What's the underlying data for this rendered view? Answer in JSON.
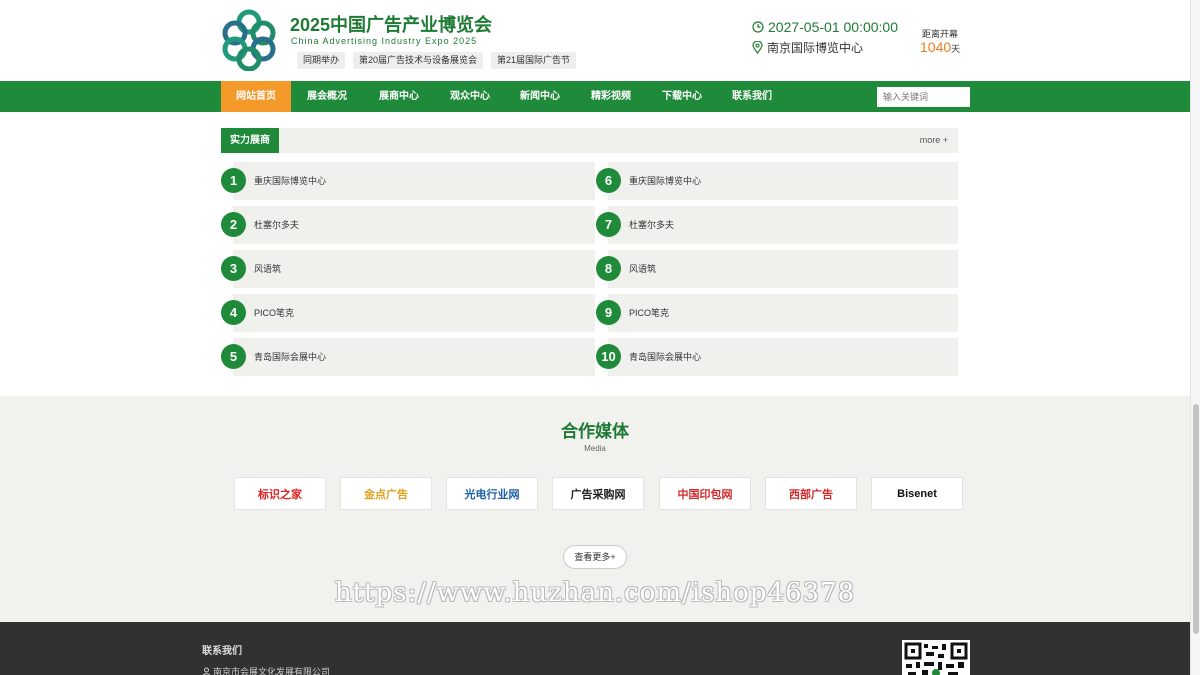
{
  "header": {
    "title": "2025中国广告产业博览会",
    "subtitle": "China Advertising Industry Expo 2025",
    "tags": [
      "同期举办",
      "第20届广告技术与设备展览会",
      "第21届国际广告节"
    ],
    "date": "2027-05-01 00:00:00",
    "venue": "南京国际博览中心",
    "countdown_label": "距离开幕",
    "countdown_value": "1040",
    "countdown_unit": "天",
    "brand_color": "#1e8a3a",
    "accent_color": "#f49a2b"
  },
  "nav": {
    "items": [
      "网站首页",
      "展会概况",
      "展商中心",
      "观众中心",
      "新闻中心",
      "精彩视频",
      "下载中心",
      "联系我们"
    ],
    "active_index": 0,
    "search_placeholder": "输入关键词"
  },
  "exhibitors": {
    "title": "实力展商",
    "more": "more +",
    "items": [
      {
        "num": "1",
        "name": "重庆国际博览中心"
      },
      {
        "num": "2",
        "name": "杜塞尔多夫"
      },
      {
        "num": "3",
        "name": "风语筑"
      },
      {
        "num": "4",
        "name": "PICO笔克"
      },
      {
        "num": "5",
        "name": "青岛国际会展中心"
      },
      {
        "num": "6",
        "name": "重庆国际博览中心"
      },
      {
        "num": "7",
        "name": "杜塞尔多夫"
      },
      {
        "num": "8",
        "name": "风语筑"
      },
      {
        "num": "9",
        "name": "PICO笔克"
      },
      {
        "num": "10",
        "name": "青岛国际会展中心"
      }
    ]
  },
  "media": {
    "title": "合作媒体",
    "subtitle": "Media",
    "logos": [
      {
        "text": "标识之家",
        "color": "#d92020"
      },
      {
        "text": "金点广告",
        "color": "#e0a020"
      },
      {
        "text": "光电行业网",
        "color": "#1d5fa8"
      },
      {
        "text": "广告采购网",
        "color": "#222222"
      },
      {
        "text": "中国印包网",
        "color": "#d02a2a"
      },
      {
        "text": "西部广告",
        "color": "#d02a2a"
      },
      {
        "text": "Bisenet",
        "color": "#111111"
      }
    ],
    "more_button": "查看更多+"
  },
  "watermark": "https://www.huzhan.com/ishop46378",
  "footer": {
    "contact_title": "联系我们",
    "company": "南京市会展文化发展有限公司"
  }
}
